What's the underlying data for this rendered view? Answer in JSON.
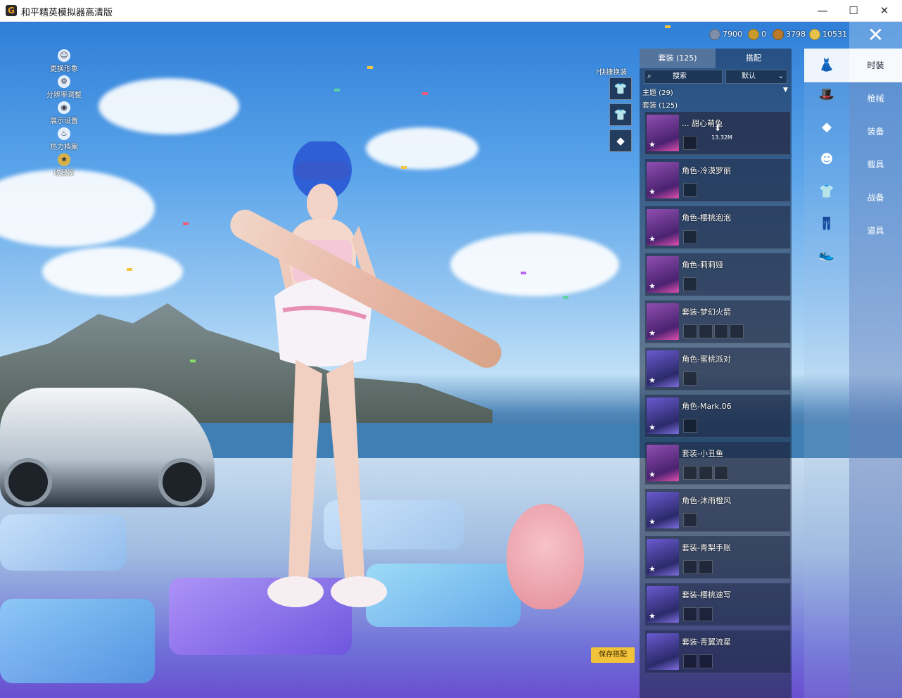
{
  "window": {
    "title": "和平精英模拟器高清版",
    "logo_glyph": "G",
    "minimize_glyph": "—",
    "maximize_glyph": "☐",
    "close_glyph": "✕"
  },
  "side_actions": [
    {
      "label": "更换形象",
      "icon": "person-icon"
    },
    {
      "label": "分辨率调整",
      "icon": "gear-icon"
    },
    {
      "label": "展示设置",
      "icon": "eye-icon"
    },
    {
      "label": "热力档案",
      "icon": "flame-icon"
    },
    {
      "label": "收藏家",
      "icon": "medal-icon"
    }
  ],
  "currency": [
    {
      "value": "7900",
      "icon": "coupon-icon",
      "color": "#7d8fa8"
    },
    {
      "value": "0",
      "icon": "token-icon",
      "color": "#c79a2d"
    },
    {
      "value": "3798",
      "icon": "bp-coin-icon",
      "color": "#b97a2a"
    },
    {
      "value": "10531",
      "icon": "gold-coin-icon",
      "color": "#e7c24a"
    }
  ],
  "close_button": {
    "glyph": "✕"
  },
  "quick_change": {
    "label": "快捷换装"
  },
  "panel": {
    "tabs": {
      "outfits": "套装 (125)",
      "match": "搭配"
    },
    "search_placeholder": "搜索",
    "sort_label": "默认",
    "theme_label": "主题 (29)",
    "set_label": "套装 (125)",
    "items": [
      {
        "name": "... 甜心萌兔",
        "download_size": "13.32M"
      },
      {
        "name": "角色-冷漠罗丽"
      },
      {
        "name": "角色-樱桃泡泡"
      },
      {
        "name": "角色-莉莉娅"
      },
      {
        "name": "套装-梦幻火箭"
      },
      {
        "name": "角色-蜜桃派对"
      },
      {
        "name": "角色-Mark.06"
      },
      {
        "name": "套装-小丑鱼"
      },
      {
        "name": "角色-沐雨橙风"
      },
      {
        "name": "套装-青梨手账"
      },
      {
        "name": "套装-樱桃速写"
      },
      {
        "name": "套装-青翼流星"
      }
    ]
  },
  "save_button": {
    "label": "保存搭配"
  },
  "right_tabs": [
    "时装",
    "枪械",
    "装备",
    "载具",
    "战备",
    "道具"
  ],
  "colors": {
    "accent_yellow": "#f2c23a",
    "panel_bg": "#1a243c"
  }
}
